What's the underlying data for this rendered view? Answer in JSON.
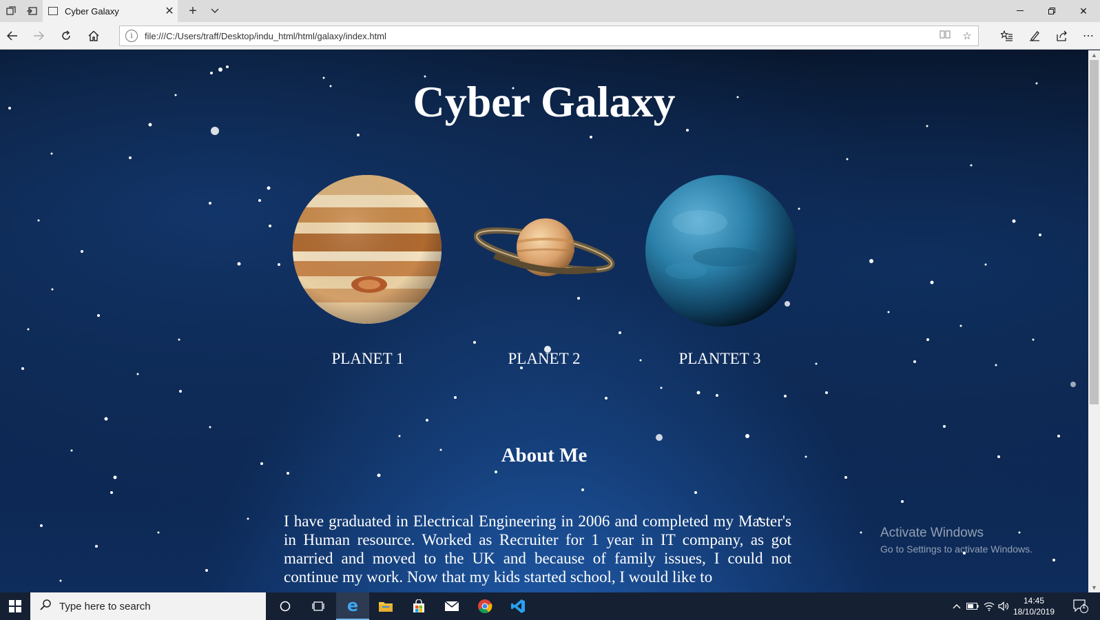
{
  "browser": {
    "tab_title": "Cyber Galaxy",
    "url": "file:///C:/Users/traff/Desktop/indu_html/html/galaxy/index.html"
  },
  "page": {
    "title": "Cyber Galaxy",
    "planets": [
      {
        "label": "PLANET 1",
        "image": "jupiter-like banded planet"
      },
      {
        "label": "PLANET 2",
        "image": "saturn-like ringed planet"
      },
      {
        "label": "PLANTET 3",
        "image": "blue ocean planet"
      }
    ],
    "about_heading": "About Me",
    "about_text": "I have graduated in Electrical Engineering in 2006 and completed my Master's in Human resource. Worked as Recruiter for 1 year in IT company, as got married and moved to the UK and because of family issues, I could not continue my work. Now that my kids started school, I would like to"
  },
  "watermark": {
    "line1": "Activate Windows",
    "line2": "Go to Settings to activate Windows."
  },
  "taskbar": {
    "search_placeholder": "Type here to search",
    "time": "14:45",
    "date": "18/10/2019",
    "notification_count": "1"
  },
  "colors": {
    "space_dark": "#071326",
    "space_blue": "#1f5aa8",
    "taskbar": "#152033"
  }
}
